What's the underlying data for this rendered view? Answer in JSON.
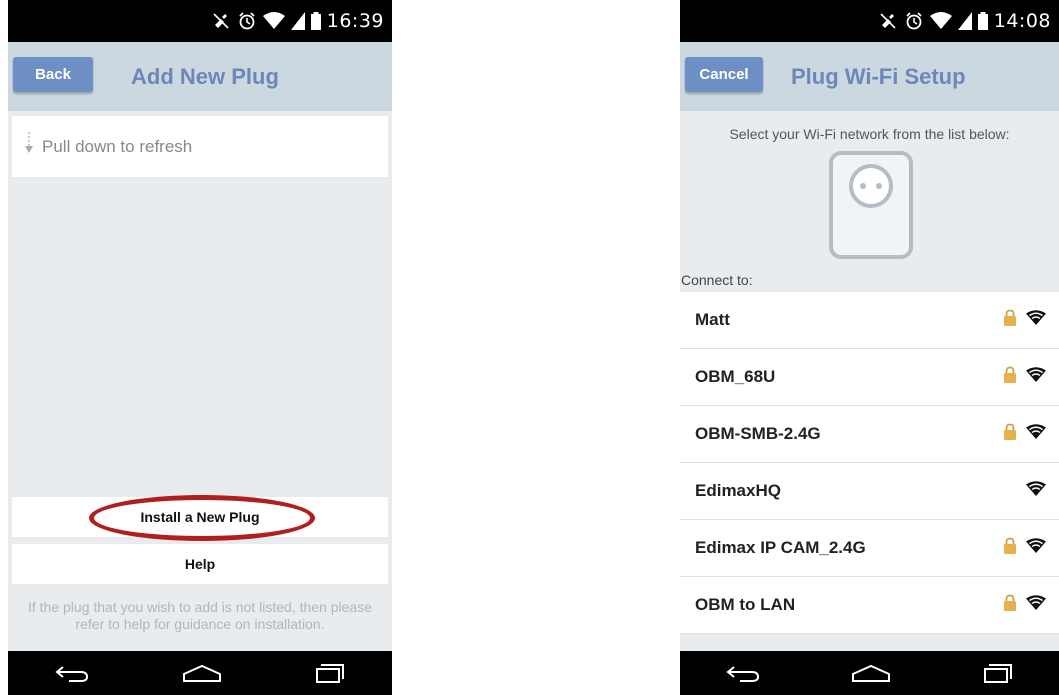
{
  "left_screen": {
    "status_bar": {
      "time": "16:39"
    },
    "title_bar": {
      "back_label": "Back",
      "title": "Add New Plug"
    },
    "refresh_hint": "Pull down to refresh",
    "install_button_label": "Install a New Plug",
    "help_button_label": "Help",
    "footer_note": "If the plug that you wish to add is not listed, then please refer to help for guidance on installation."
  },
  "right_screen": {
    "status_bar": {
      "time": "14:08"
    },
    "title_bar": {
      "cancel_label": "Cancel",
      "title": "Plug Wi-Fi Setup"
    },
    "instruction": "Select your Wi-Fi network from the list below:",
    "connect_label": "Connect to:",
    "networks": [
      {
        "name": "Matt",
        "secured": true
      },
      {
        "name": "OBM_68U",
        "secured": true
      },
      {
        "name": "OBM-SMB-2.4G",
        "secured": true
      },
      {
        "name": "EdimaxHQ",
        "secured": false
      },
      {
        "name": "Edimax IP CAM_2.4G",
        "secured": true
      },
      {
        "name": "OBM to LAN",
        "secured": true
      }
    ]
  },
  "colors": {
    "title_bar": "#cbd8e0",
    "nav_button": "#6d8fc4",
    "title_text": "#6e86b8",
    "highlight_oval": "#b01e1e",
    "background": "#e9ecef"
  },
  "icons": {
    "status_bar": [
      "mute-icon",
      "alarm-icon",
      "wifi-icon",
      "signal-icon",
      "battery-icon"
    ],
    "nav_bar": [
      "back-nav-icon",
      "home-nav-icon",
      "recent-apps-icon"
    ],
    "wifi_row": [
      "lock-icon",
      "wifi-signal-icon"
    ]
  }
}
